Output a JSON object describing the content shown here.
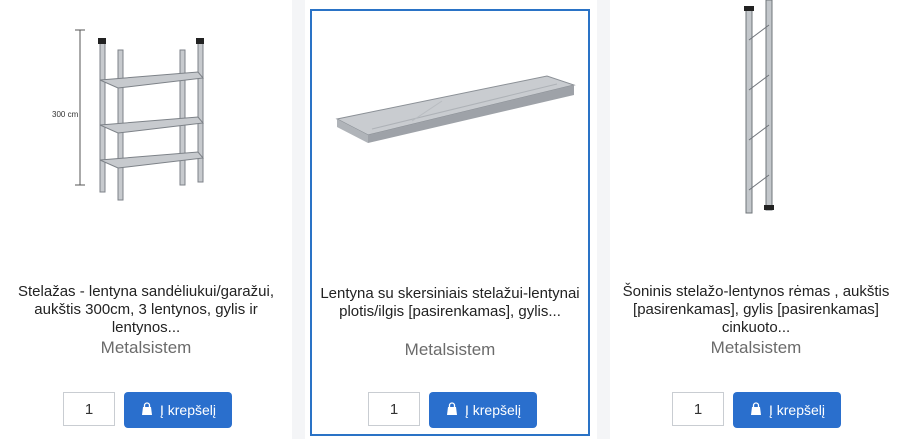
{
  "products": [
    {
      "title": "Stelažas - lentyna sandėliukui/garažui, aukštis 300cm, 3 lentynos, gylis ir lentynos...",
      "brand": "Metalsistem",
      "quantity": "1",
      "cart_label": "Į krepšelį",
      "image_label": "300 cm"
    },
    {
      "title": "Lentyna su skersiniais stelažui-lentynai plotis/ilgis [pasirenkamas], gylis...",
      "brand": "Metalsistem",
      "quantity": "1",
      "cart_label": "Į krepšelį"
    },
    {
      "title": "Šoninis stelažo-lentynos rėmas , aukštis [pasirenkamas], gylis [pasirenkamas] cinkuoto...",
      "brand": "Metalsistem",
      "quantity": "1",
      "cart_label": "Į krepšelį"
    }
  ],
  "colors": {
    "accent": "#2a6fcd",
    "highlight_border": "#2a73c6"
  },
  "icons": {
    "cart": "shopping-bag-icon"
  }
}
